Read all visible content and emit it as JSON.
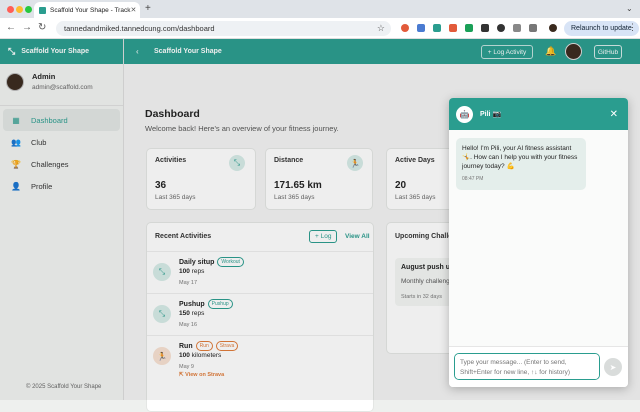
{
  "browser": {
    "tab_title": "Scaffold Your Shape - Track",
    "url": "tannedandmiked.tannedcung.com/dashboard",
    "relaunch_label": "Relaunch to update"
  },
  "colors": {
    "brand": "#2a9d8f",
    "strava": "#e07b39"
  },
  "sidebar": {
    "brand": "Scaffold Your Shape",
    "user": {
      "name": "Admin",
      "email": "admin@scaffold.com"
    },
    "items": [
      {
        "label": "Dashboard",
        "icon": "dashboard-icon",
        "active": true
      },
      {
        "label": "Club",
        "icon": "club-icon"
      },
      {
        "label": "Challenges",
        "icon": "trophy-icon"
      },
      {
        "label": "Profile",
        "icon": "profile-icon"
      }
    ],
    "footer": "© 2025 Scaffold Your Shape"
  },
  "topbar": {
    "breadcrumb": "Scaffold Your Shape",
    "log_activity": "+ Log Activity",
    "github": "GitHub"
  },
  "main": {
    "title": "Dashboard",
    "subtitle": "Welcome back! Here's an overview of your fitness journey.",
    "stats": [
      {
        "label": "Activities",
        "value": "36",
        "period": "Last 365 days"
      },
      {
        "label": "Distance",
        "value": "171.65 km",
        "period": "Last 365 days"
      },
      {
        "label": "Active Days",
        "value": "20",
        "period": "Last 365 days"
      }
    ],
    "recent": {
      "title": "Recent Activities",
      "log_btn": "+ Log",
      "view_all": "View All",
      "items": [
        {
          "name": "Daily situp",
          "badges": [
            "Workout"
          ],
          "amount": "100",
          "unit": "reps",
          "date": "May 17"
        },
        {
          "name": "Pushup",
          "badges": [
            "Pushup"
          ],
          "amount": "150",
          "unit": "reps",
          "date": "May 16"
        },
        {
          "name": "Run",
          "badges": [
            "Run",
            "Strava"
          ],
          "amount": "100",
          "unit": "kilometers",
          "date": "May 9",
          "link": "View on Strava"
        }
      ]
    },
    "upcoming": {
      "title": "Upcoming Challenges",
      "challenge": {
        "name": "August push up",
        "desc": "Monthly challenge",
        "starts": "Starts in 32 days"
      }
    }
  },
  "chat": {
    "title": "Pili",
    "message": "Hello! I'm Pili, your AI fitness assistant 🤸. How can I help you with your fitness journey today? 💪",
    "time": "08:47 PM",
    "placeholder": "Type your message... (Enter to send, Shift+Enter for new line, ↑↓ for history)"
  }
}
